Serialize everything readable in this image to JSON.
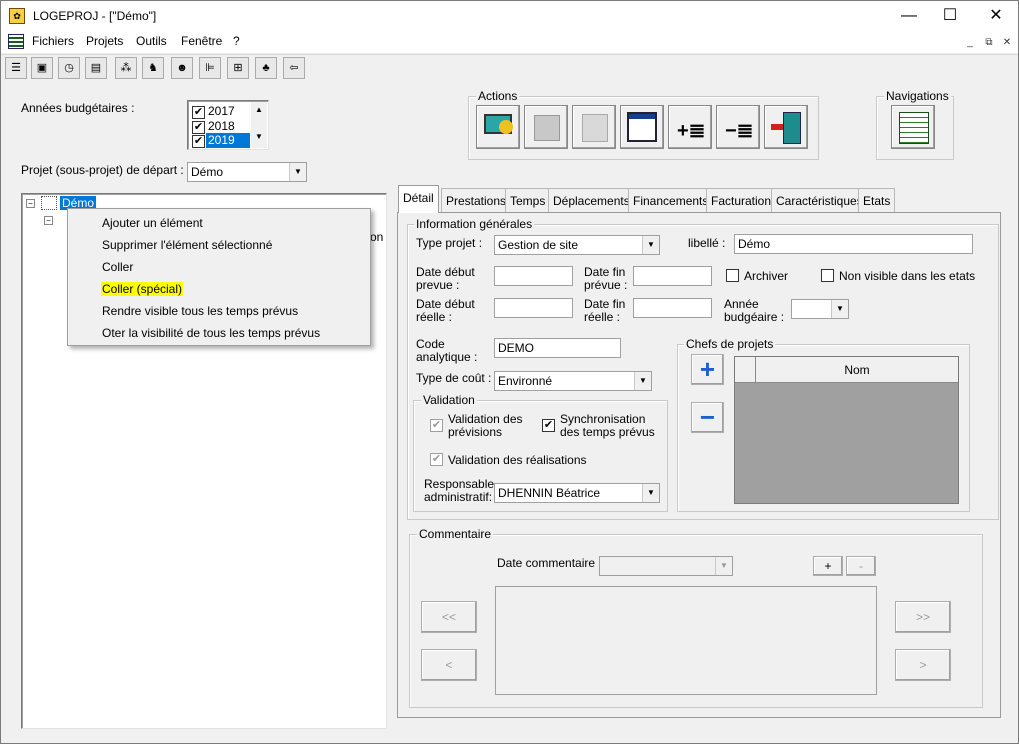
{
  "window": {
    "title": "LOGEPROJ - [\"Démo\"]",
    "min": "—",
    "max": "☐",
    "close": "✕"
  },
  "menu": {
    "items": [
      "Fichiers",
      "Projets",
      "Outils",
      "Fenêtre",
      "?"
    ],
    "mdi": [
      "_",
      "⧉",
      "✕"
    ]
  },
  "left": {
    "years_label": "Années budgétaires :",
    "years": [
      {
        "label": "2017",
        "checked": "✔"
      },
      {
        "label": "2018",
        "checked": "✔"
      },
      {
        "label": "2019",
        "checked": "✔"
      }
    ],
    "start_label": "Projet (sous-projet) de départ :",
    "start_value": "Démo",
    "tree_root": "Démo",
    "tree_hidden_fragment": "on"
  },
  "context_menu": {
    "items": [
      "Ajouter un élément",
      "Supprimer l'élément sélectionné",
      "Coller",
      "Coller (spécial)",
      "Rendre visible tous les temps prévus",
      "Oter la visibilité de tous les temps prévus"
    ],
    "highlighted_index": 3
  },
  "actions": {
    "title": "Actions"
  },
  "navigations": {
    "title": "Navigations"
  },
  "tabs": [
    "Détail",
    "Prestations",
    "Temps",
    "Déplacements",
    "Financements",
    "Facturation",
    "Caractéristiques",
    "Etats"
  ],
  "detail": {
    "info_title": "Information générales",
    "type_label": "Type  projet :",
    "type_value": "Gestion de site",
    "libelle_label": "libellé :",
    "libelle_value": "Démo",
    "date_debut_prevue": "Date début\nprevue :",
    "date_fin_prevue": "Date fin\nprévue :",
    "archiver": "Archiver",
    "non_visible": "Non visible dans les etats",
    "date_debut_reelle": "Date début\nréelle :",
    "date_fin_reelle": "Date fin\nréelle :",
    "annee_budgetaire": "Année\nbudgéaire :",
    "code_label": "Code\nanalytique :",
    "code_value": "DEMO",
    "cout_label": "Type de coût :",
    "cout_value": "Environné",
    "validation_title": "Validation",
    "val_previsions": "Validation des\nprévisions",
    "sync_temps": "Synchronisation\ndes temps prévus",
    "val_realisations": "Validation des réalisations",
    "responsable_label": "Responsable\nadministratif:",
    "responsable_value": "DHENNIN Béatrice",
    "chefs_title": "Chefs de projets",
    "chefs_col": "Nom",
    "add": "+",
    "remove": "−",
    "comment_title": "Commentaire",
    "date_comment_label": "Date commentaire :",
    "comment_add": "+",
    "comment_remove": "-",
    "nav_first": "<<",
    "nav_prev": "<",
    "nav_last": ">>",
    "nav_next": ">"
  },
  "colors": {
    "selection": "#0078d7",
    "highlight": "#ffff00",
    "grid_bg": "#a0a0a0",
    "plus_blue": "#1e5fd0"
  }
}
